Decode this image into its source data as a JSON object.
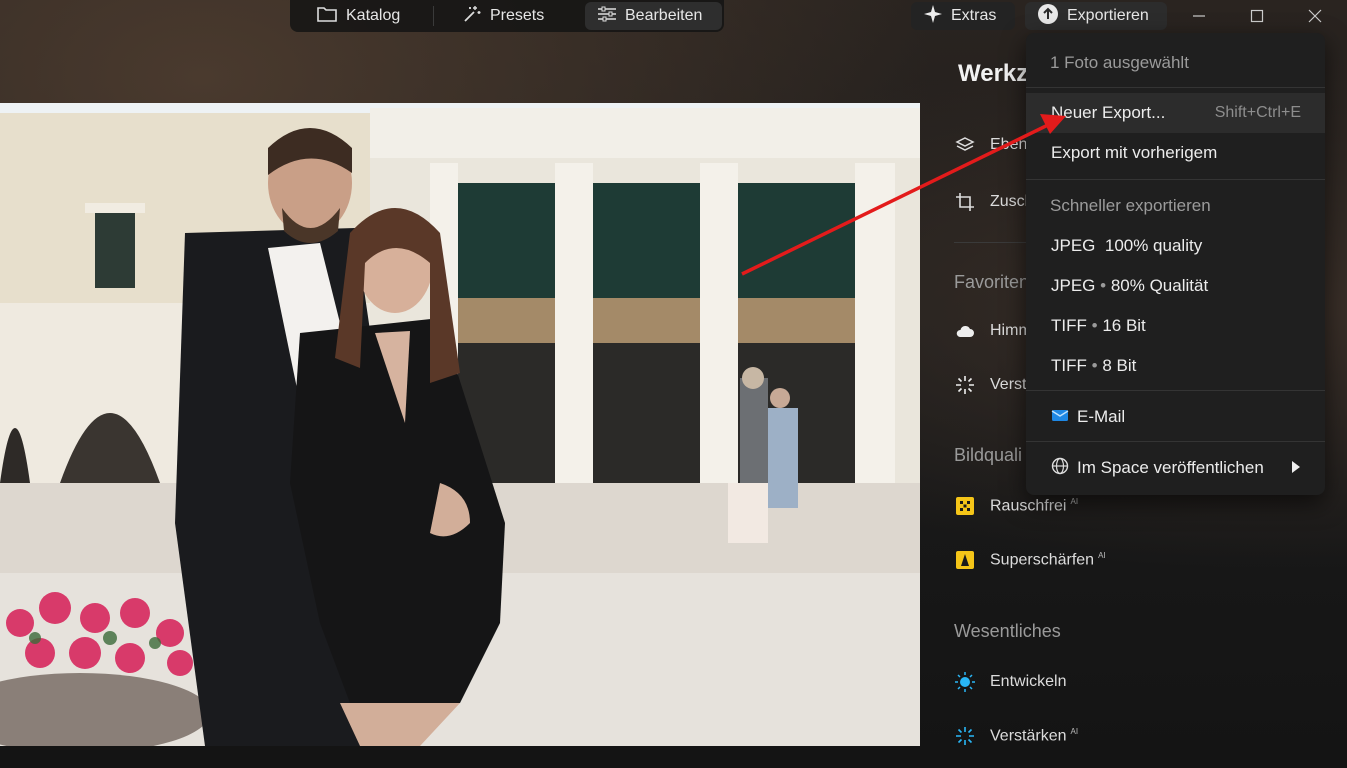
{
  "topbar": {
    "tabs": [
      {
        "label": "Katalog",
        "icon": "folder-icon"
      },
      {
        "label": "Presets",
        "icon": "magic-wand-icon"
      },
      {
        "label": "Bearbeiten",
        "icon": "sliders-icon"
      }
    ],
    "extras_label": "Extras",
    "export_label": "Exportieren",
    "window_controls": [
      "minimize-icon",
      "maximize-icon",
      "close-icon"
    ]
  },
  "panel": {
    "title": "Werkz",
    "tools": [
      {
        "label": "Ebene",
        "icon": "layers-icon"
      },
      {
        "label": "Zusch",
        "icon": "crop-icon"
      }
    ],
    "sections": [
      {
        "title": "Favoriten",
        "items": [
          {
            "label": "Himm",
            "icon": "cloud-icon"
          },
          {
            "label": "Verst",
            "icon": "sparkle-icon"
          }
        ]
      },
      {
        "title": "Bildquali",
        "items": [
          {
            "label": "Rauschfrei",
            "badge": "AI",
            "icon": "denoise-icon"
          },
          {
            "label": "Superschärfen",
            "badge": "AI",
            "icon": "sharpen-icon"
          }
        ]
      },
      {
        "title": "Wesentliches",
        "items": [
          {
            "label": "Entwickeln",
            "icon": "sun-icon"
          },
          {
            "label": "Verstärken",
            "badge": "AI",
            "icon": "sparkle-blue-icon"
          }
        ]
      }
    ]
  },
  "export_menu": {
    "header": "1 Foto ausgewählt",
    "new_export": {
      "label": "Neuer Export...",
      "shortcut": "Shift+Ctrl+E"
    },
    "export_previous": "Export mit vorherigem",
    "quick_header": "Schneller exportieren",
    "quick_items": [
      {
        "format": "JPEG",
        "detail": "100% quality",
        "dot": false
      },
      {
        "format": "JPEG",
        "detail": "80% Qualität",
        "dot": true
      },
      {
        "format": "TIFF",
        "detail": "16 Bit",
        "dot": true
      },
      {
        "format": "TIFF",
        "detail": "8 Bit",
        "dot": true
      }
    ],
    "email": "E-Mail",
    "space": "Im Space veröffentlichen"
  },
  "colors": {
    "menu_bg": "#1f1f1f",
    "accent_red": "#e31b1b",
    "ai_yellow": "#f5c518",
    "sun_blue": "#29b6f6"
  }
}
